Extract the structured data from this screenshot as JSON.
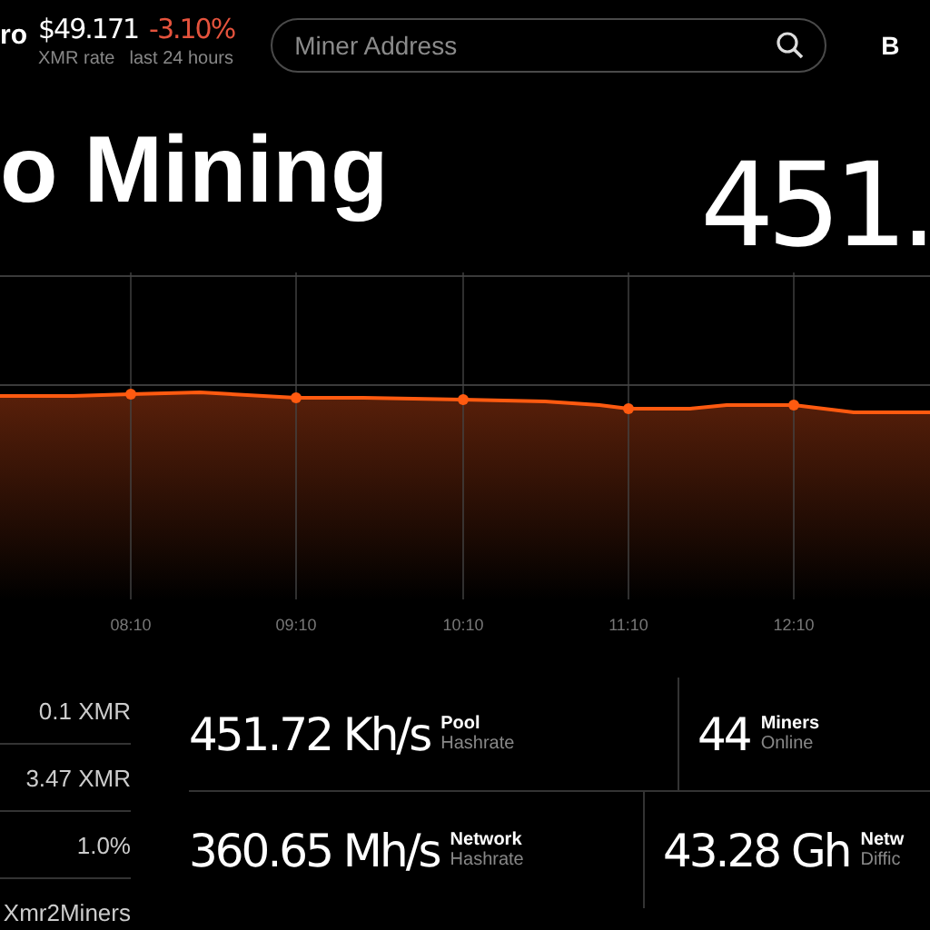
{
  "header": {
    "coin_fragment": "ro",
    "price": "$49.171",
    "price_label": "XMR rate",
    "change": "-3.10%",
    "change_label": "last 24 hours",
    "search": {
      "placeholder": "Miner Address"
    },
    "nav_fragment": "B"
  },
  "hero": {
    "title": "o Mining",
    "big_value": "451."
  },
  "chart": {
    "time_labels": [
      "08:10",
      "09:10",
      "10:10",
      "11:10",
      "12:10"
    ]
  },
  "pool_info": [
    "0.1 XMR",
    "3.47 XMR",
    "1.0%",
    "Xmr2Miners"
  ],
  "stats": [
    [
      {
        "value": "451.72 Kh/s",
        "title": "Pool",
        "subtitle": "Hashrate"
      },
      {
        "value": "44",
        "title": "Miners",
        "subtitle": "Online"
      }
    ],
    [
      {
        "value": "360.65 Mh/s",
        "title": "Network",
        "subtitle": "Hashrate"
      },
      {
        "value": "43.28 Gh",
        "title": "Netw",
        "subtitle": "Diffic"
      }
    ]
  ]
}
